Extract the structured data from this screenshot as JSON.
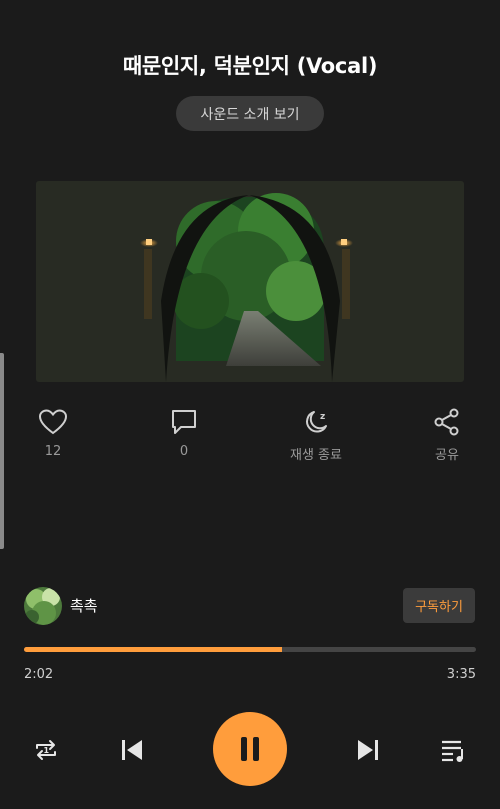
{
  "track": {
    "title": "때문인지, 덕분인지 (Vocal)",
    "intro_button": "사운드 소개 보기"
  },
  "artwork": {
    "description_icon": "tunnel-photo"
  },
  "actions": {
    "like_count": "12",
    "comment_count": "0",
    "sleep_timer_label": "재생 종료",
    "share_label": "공유"
  },
  "artist": {
    "name": "촉촉",
    "subscribe_label": "구독하기"
  },
  "playback": {
    "current_time": "2:02",
    "total_time": "3:35",
    "progress_fraction": 0.57
  },
  "colors": {
    "accent": "#ff9d3c",
    "background": "#1b1b1b"
  },
  "icons": {
    "like": "heart-icon",
    "comment": "comment-icon",
    "sleep": "moon-sleep-icon",
    "share": "share-icon",
    "repeat": "repeat-one-icon",
    "previous": "skip-previous-icon",
    "play_pause": "pause-icon",
    "next": "skip-next-icon",
    "playlist": "playlist-icon"
  }
}
